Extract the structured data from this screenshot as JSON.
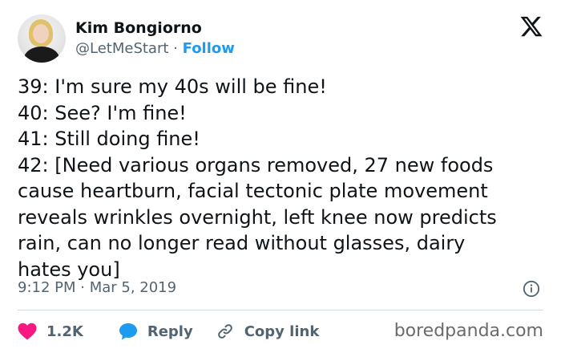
{
  "author": {
    "name": "Kim Bongiorno",
    "handle": "@LetMeStart",
    "separator": "·",
    "follow_label": "Follow"
  },
  "tweet": {
    "lines": [
      "39: I'm sure my 40s will be fine!",
      "40: See? I'm fine!",
      "41: Still doing fine!",
      "42: [Need various organs removed, 27 new foods",
      "cause heartburn, facial tectonic plate movement",
      "reveals wrinkles overnight, left knee now predicts",
      "rain, can no longer read without glasses, dairy",
      "hates you]"
    ],
    "timestamp": "9:12 PM · Mar 5, 2019"
  },
  "actions": {
    "likes": "1.2K",
    "reply_label": "Reply",
    "copy_link_label": "Copy link"
  },
  "icons": {
    "platform_logo": "x-logo-icon",
    "info": "info-icon",
    "like": "heart-icon",
    "reply": "speech-bubble-icon",
    "copy": "link-icon"
  },
  "colors": {
    "accent": "#1d9bf0",
    "like": "#f91880",
    "secondary_text": "#536471"
  },
  "watermark": "boredpanda.com"
}
